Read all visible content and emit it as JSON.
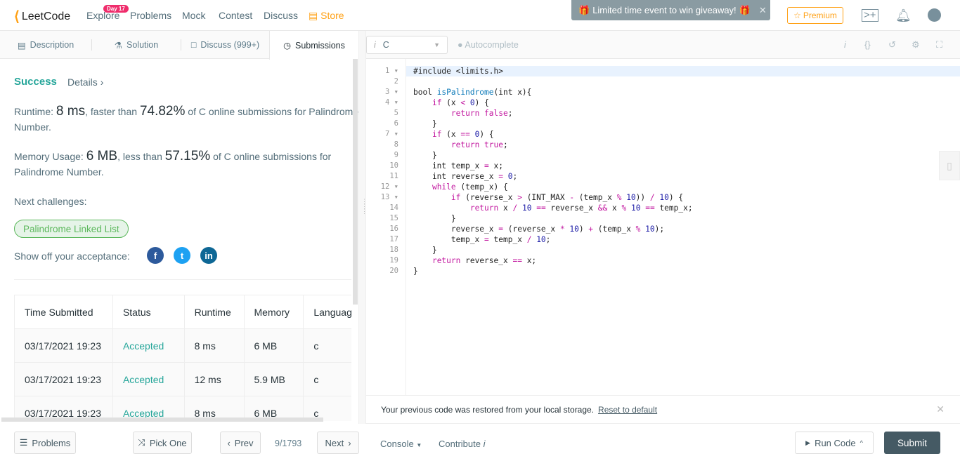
{
  "nav": {
    "logo": "LeetCode",
    "badge": "Day 17",
    "items": [
      "Explore",
      "Problems",
      "Mock",
      "Contest",
      "Discuss"
    ],
    "store": "Store",
    "promo": "Limited time event to win giveaway!",
    "premium": "Premium"
  },
  "left_tabs": [
    "Description",
    "Solution",
    "Discuss (999+)",
    "Submissions"
  ],
  "result": {
    "status": "Success",
    "details": "Details",
    "runtime_label": "Runtime: ",
    "runtime": "8 ms",
    "runtime_mid": ", faster than ",
    "runtime_pct": "74.82%",
    "runtime_tail": " of C online submissions for Palindrome Number.",
    "memory_label": "Memory Usage: ",
    "memory": "6 MB",
    "memory_mid": ", less than ",
    "memory_pct": "57.15%",
    "memory_tail": " of C online submissions for Palindrome Number.",
    "next_label": "Next challenges:",
    "next_challenge": "Palindrome Linked List",
    "share_label": "Show off your acceptance:"
  },
  "table": {
    "headers": [
      "Time Submitted",
      "Status",
      "Runtime",
      "Memory",
      "Language"
    ],
    "rows": [
      [
        "03/17/2021 19:23",
        "Accepted",
        "8 ms",
        "6 MB",
        "c"
      ],
      [
        "03/17/2021 19:23",
        "Accepted",
        "12 ms",
        "5.9 MB",
        "c"
      ],
      [
        "03/17/2021 19:23",
        "Accepted",
        "8 ms",
        "6 MB",
        "c"
      ]
    ]
  },
  "editor": {
    "language": "C",
    "autocomplete": "Autocomplete",
    "lines": [
      [
        [
          "p",
          "#include <limits.h>"
        ]
      ],
      [],
      [
        [
          "p",
          "bool "
        ],
        [
          "f",
          "isPalindrome"
        ],
        [
          "p",
          "(int x){"
        ]
      ],
      [
        [
          "p",
          "    "
        ],
        [
          "k",
          "if"
        ],
        [
          "p",
          " (x "
        ],
        [
          "o",
          "<"
        ],
        [
          "p",
          " "
        ],
        [
          "n",
          "0"
        ],
        [
          "p",
          ") {"
        ]
      ],
      [
        [
          "p",
          "        "
        ],
        [
          "k",
          "return false"
        ],
        [
          "p",
          ";"
        ]
      ],
      [
        [
          "p",
          "    }"
        ]
      ],
      [
        [
          "p",
          "    "
        ],
        [
          "k",
          "if"
        ],
        [
          "p",
          " (x "
        ],
        [
          "o",
          "=="
        ],
        [
          "p",
          " "
        ],
        [
          "n",
          "0"
        ],
        [
          "p",
          ") {"
        ]
      ],
      [
        [
          "p",
          "        "
        ],
        [
          "k",
          "return true"
        ],
        [
          "p",
          ";"
        ]
      ],
      [
        [
          "p",
          "    }"
        ]
      ],
      [
        [
          "p",
          "    int temp_x "
        ],
        [
          "o",
          "="
        ],
        [
          "p",
          " x;"
        ]
      ],
      [
        [
          "p",
          "    int reverse_x "
        ],
        [
          "o",
          "="
        ],
        [
          "p",
          " "
        ],
        [
          "n",
          "0"
        ],
        [
          "p",
          ";"
        ]
      ],
      [
        [
          "p",
          "    "
        ],
        [
          "k",
          "while"
        ],
        [
          "p",
          " (temp_x) {"
        ]
      ],
      [
        [
          "p",
          "        "
        ],
        [
          "k",
          "if"
        ],
        [
          "p",
          " (reverse_x "
        ],
        [
          "o",
          ">"
        ],
        [
          "p",
          " (INT_MAX "
        ],
        [
          "o",
          "-"
        ],
        [
          "p",
          " (temp_x "
        ],
        [
          "o",
          "%"
        ],
        [
          "p",
          " "
        ],
        [
          "n",
          "10"
        ],
        [
          "p",
          ")) "
        ],
        [
          "o",
          "/"
        ],
        [
          "p",
          " "
        ],
        [
          "n",
          "10"
        ],
        [
          "p",
          ") {"
        ]
      ],
      [
        [
          "p",
          "            "
        ],
        [
          "k",
          "return"
        ],
        [
          "p",
          " x "
        ],
        [
          "o",
          "/"
        ],
        [
          "p",
          " "
        ],
        [
          "n",
          "10"
        ],
        [
          "p",
          " "
        ],
        [
          "o",
          "=="
        ],
        [
          "p",
          " reverse_x "
        ],
        [
          "o",
          "&&"
        ],
        [
          "p",
          " x "
        ],
        [
          "o",
          "%"
        ],
        [
          "p",
          " "
        ],
        [
          "n",
          "10"
        ],
        [
          "p",
          " "
        ],
        [
          "o",
          "=="
        ],
        [
          "p",
          " temp_x;"
        ]
      ],
      [
        [
          "p",
          "        }"
        ]
      ],
      [
        [
          "p",
          "        reverse_x "
        ],
        [
          "o",
          "="
        ],
        [
          "p",
          " (reverse_x "
        ],
        [
          "o",
          "*"
        ],
        [
          "p",
          " "
        ],
        [
          "n",
          "10"
        ],
        [
          "p",
          ") "
        ],
        [
          "o",
          "+"
        ],
        [
          "p",
          " (temp_x "
        ],
        [
          "o",
          "%"
        ],
        [
          "p",
          " "
        ],
        [
          "n",
          "10"
        ],
        [
          "p",
          ");"
        ]
      ],
      [
        [
          "p",
          "        temp_x "
        ],
        [
          "o",
          "="
        ],
        [
          "p",
          " temp_x "
        ],
        [
          "o",
          "/"
        ],
        [
          "p",
          " "
        ],
        [
          "n",
          "10"
        ],
        [
          "p",
          ";"
        ]
      ],
      [
        [
          "p",
          "    }"
        ]
      ],
      [
        [
          "p",
          "    "
        ],
        [
          "k",
          "return"
        ],
        [
          "p",
          " reverse_x "
        ],
        [
          "o",
          "=="
        ],
        [
          "p",
          " x;"
        ]
      ],
      [
        [
          "p",
          "}"
        ]
      ]
    ],
    "foldable_lines": [
      1,
      3,
      4,
      7,
      12,
      13
    ]
  },
  "notice": {
    "text": "Your previous code was restored from your local storage.",
    "reset": "Reset to default"
  },
  "bottom": {
    "problems": "Problems",
    "pick_one": "Pick One",
    "prev": "Prev",
    "page": "9/1793",
    "next": "Next",
    "console": "Console",
    "contribute": "Contribute",
    "run": "Run Code",
    "submit": "Submit"
  },
  "colors": {
    "accent": "#ffa116",
    "success": "#26a69a",
    "submit_bg": "#455a64"
  }
}
